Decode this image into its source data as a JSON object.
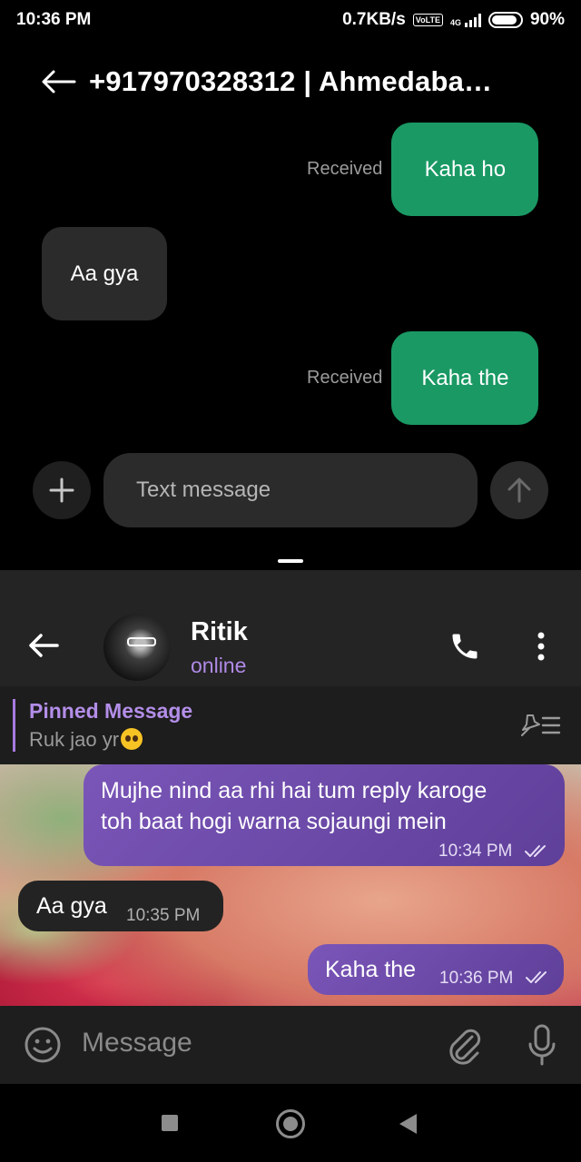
{
  "status_bar": {
    "time": "10:36 PM",
    "speed": "0.7KB/s",
    "volte": "Vo LTE",
    "network": "4G",
    "battery": "90%",
    "battery_level": 0.9
  },
  "sms": {
    "title": "+917970328312 | Ahmedaba…",
    "messages": [
      {
        "direction": "outgoing",
        "text": "Kaha ho",
        "status": "Received"
      },
      {
        "direction": "incoming",
        "text": "Aa gya"
      },
      {
        "direction": "outgoing",
        "text": "Kaha the",
        "status": "Received"
      }
    ],
    "compose_placeholder": "Text message"
  },
  "telegram": {
    "contact_name": "Ritik",
    "contact_status": "online",
    "pinned": {
      "title": "Pinned Message",
      "text": "Ruk jao yr"
    },
    "messages": [
      {
        "direction": "outgoing",
        "text_line1": "Mujhe nind aa rhi hai tum reply karoge",
        "text_line2": "toh baat hogi warna sojaungi mein",
        "time": "10:34 PM"
      },
      {
        "direction": "incoming",
        "text": "Aa gya",
        "time": "10:35 PM"
      },
      {
        "direction": "outgoing",
        "text": "Kaha the",
        "time": "10:36 PM"
      }
    ],
    "input_placeholder": "Message"
  },
  "colors": {
    "sms_outgoing": "#1a9964",
    "sms_incoming": "#2b2b2b",
    "tg_accent": "#a67be0",
    "tg_outgoing": "#6a48a8"
  }
}
